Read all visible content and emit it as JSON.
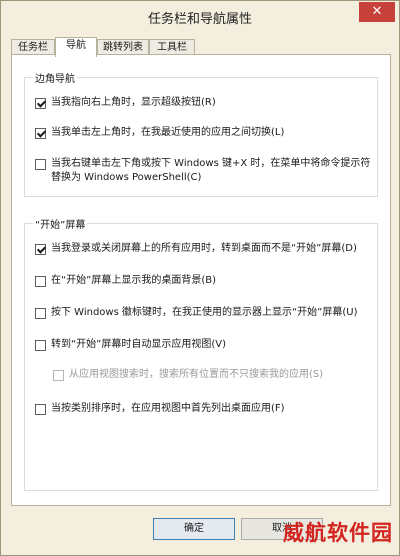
{
  "window": {
    "title": "任务栏和导航属性",
    "close_glyph": "✕"
  },
  "tabs": [
    {
      "label": "任务栏",
      "active": false
    },
    {
      "label": "导航",
      "active": true
    },
    {
      "label": "跳转列表",
      "active": false
    },
    {
      "label": "工具栏",
      "active": false
    }
  ],
  "corner_nav": {
    "title": "边角导航",
    "options": [
      {
        "label": "当我指向右上角时，显示超级按钮(R)",
        "checked": true
      },
      {
        "label": "当我单击左上角时，在我最近使用的应用之间切换(L)",
        "checked": true
      },
      {
        "label": "当我右键单击左下角或按下 Windows 键+X 时，在菜单中将命令提示符替换为 Windows PowerShell(C)",
        "checked": false
      }
    ]
  },
  "start_screen": {
    "title": "“开始”屏幕",
    "options": [
      {
        "label": "当我登录或关闭屏幕上的所有应用时，转到桌面而不是“开始”屏幕(D)",
        "checked": true
      },
      {
        "label": "在“开始”屏幕上显示我的桌面背景(B)",
        "checked": false
      },
      {
        "label": "按下 Windows 徽标键时，在我正使用的显示器上显示“开始”屏幕(U)",
        "checked": false
      },
      {
        "label": "转到“开始”屏幕时自动显示应用视图(V)",
        "checked": false
      },
      {
        "label": "从应用视图搜索时，搜索所有位置而不只搜索我的应用(S)",
        "checked": false,
        "disabled": true
      },
      {
        "label": "当按类别排序时，在应用视图中首先列出桌面应用(F)",
        "checked": false
      }
    ]
  },
  "buttons": {
    "ok": "确定",
    "cancel": "取消"
  },
  "watermark": "威航软件园"
}
